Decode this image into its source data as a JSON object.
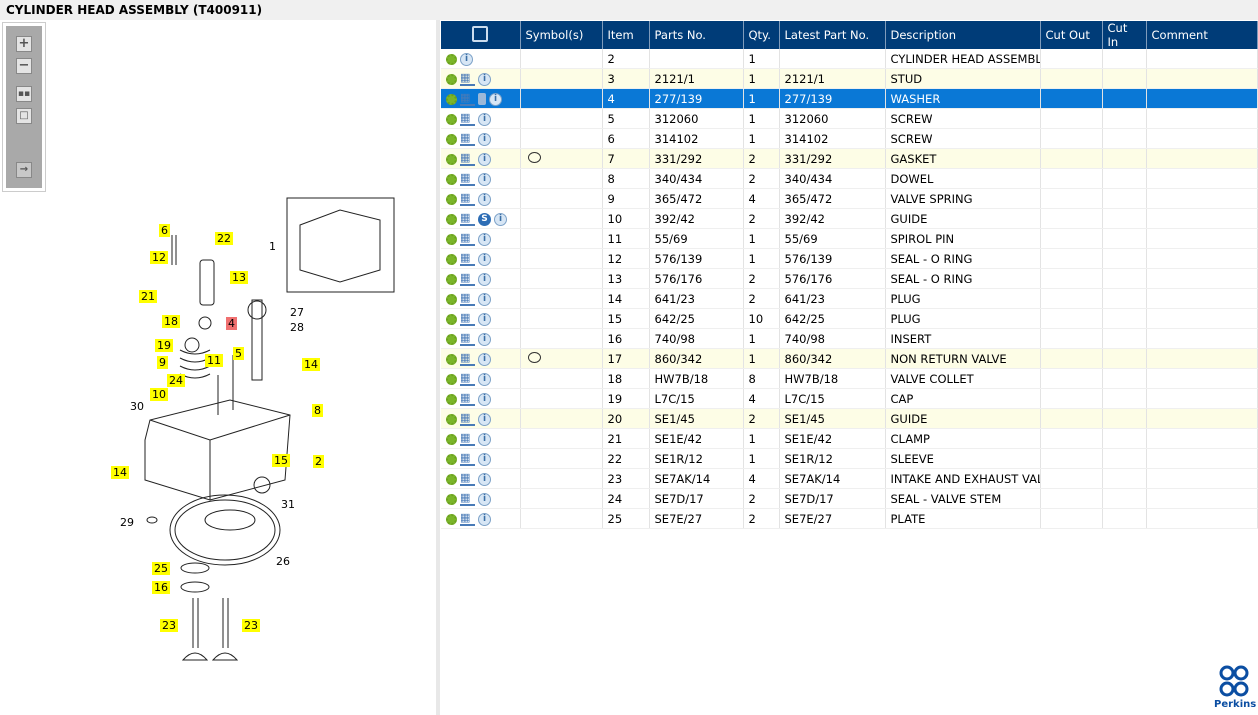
{
  "title": "CYLINDER HEAD ASSEMBLY (T400911)",
  "toolbar": {
    "zoom_in": "+",
    "zoom_out": "−"
  },
  "diagram": {
    "labels": [
      {
        "t": "6",
        "hl": "yellow"
      },
      {
        "t": "22",
        "hl": "yellow"
      },
      {
        "t": "12",
        "hl": "yellow"
      },
      {
        "t": "13",
        "hl": "yellow"
      },
      {
        "t": "21",
        "hl": "yellow"
      },
      {
        "t": "18",
        "hl": "yellow"
      },
      {
        "t": "4",
        "hl": "red"
      },
      {
        "t": "19",
        "hl": "yellow"
      },
      {
        "t": "5",
        "hl": "yellow"
      },
      {
        "t": "14",
        "hl": "yellow"
      },
      {
        "t": "9",
        "hl": "yellow"
      },
      {
        "t": "11",
        "hl": "yellow"
      },
      {
        "t": "24",
        "hl": "yellow"
      },
      {
        "t": "10",
        "hl": "yellow"
      },
      {
        "t": "8",
        "hl": "yellow"
      },
      {
        "t": "14",
        "hl": "yellow"
      },
      {
        "t": "15",
        "hl": "yellow"
      },
      {
        "t": "2",
        "hl": "yellow"
      },
      {
        "t": "25",
        "hl": "yellow"
      },
      {
        "t": "16",
        "hl": "yellow"
      },
      {
        "t": "23",
        "hl": "yellow"
      },
      {
        "t": "23",
        "hl": "yellow"
      }
    ],
    "plain_labels": [
      "1",
      "27",
      "28",
      "30",
      "31",
      "29",
      "26"
    ]
  },
  "grid": {
    "columns": [
      "",
      "Symbol(s)",
      "Item",
      "Parts No.",
      "Qty.",
      "Latest Part No.",
      "Description",
      "Cut Out",
      "Cut In",
      "Comment"
    ],
    "rows": [
      {
        "icons": [
          "gear",
          "info"
        ],
        "sym": "",
        "item": "2",
        "part": "",
        "qty": "1",
        "latest": "",
        "desc": "CYLINDER HEAD ASSEMBLY",
        "state": ""
      },
      {
        "icons": [
          "gear",
          "cart",
          "info"
        ],
        "sym": "",
        "item": "3",
        "part": "2121/1",
        "qty": "1",
        "latest": "2121/1",
        "desc": "STUD",
        "state": "hl"
      },
      {
        "icons": [
          "gear",
          "cart",
          "doc",
          "info"
        ],
        "sym": "",
        "item": "4",
        "part": "277/139",
        "qty": "1",
        "latest": "277/139",
        "desc": "WASHER",
        "state": "sel"
      },
      {
        "icons": [
          "gear",
          "cart",
          "info"
        ],
        "sym": "",
        "item": "5",
        "part": "312060",
        "qty": "1",
        "latest": "312060",
        "desc": "SCREW",
        "state": ""
      },
      {
        "icons": [
          "gear",
          "cart",
          "info"
        ],
        "sym": "",
        "item": "6",
        "part": "314102",
        "qty": "1",
        "latest": "314102",
        "desc": "SCREW",
        "state": ""
      },
      {
        "icons": [
          "gear",
          "cart",
          "info"
        ],
        "sym": "note",
        "item": "7",
        "part": "331/292",
        "qty": "2",
        "latest": "331/292",
        "desc": "GASKET",
        "state": "hl"
      },
      {
        "icons": [
          "gear",
          "cart",
          "info"
        ],
        "sym": "",
        "item": "8",
        "part": "340/434",
        "qty": "2",
        "latest": "340/434",
        "desc": "DOWEL",
        "state": ""
      },
      {
        "icons": [
          "gear",
          "cart",
          "info"
        ],
        "sym": "",
        "item": "9",
        "part": "365/472",
        "qty": "4",
        "latest": "365/472",
        "desc": "VALVE SPRING",
        "state": ""
      },
      {
        "icons": [
          "gear",
          "cart",
          "s",
          "info"
        ],
        "sym": "",
        "item": "10",
        "part": "392/42",
        "qty": "2",
        "latest": "392/42",
        "desc": "GUIDE",
        "state": ""
      },
      {
        "icons": [
          "gear",
          "cart",
          "info"
        ],
        "sym": "",
        "item": "11",
        "part": "55/69",
        "qty": "1",
        "latest": "55/69",
        "desc": "SPIROL PIN",
        "state": ""
      },
      {
        "icons": [
          "gear",
          "cart",
          "info"
        ],
        "sym": "",
        "item": "12",
        "part": "576/139",
        "qty": "1",
        "latest": "576/139",
        "desc": "SEAL - O RING",
        "state": ""
      },
      {
        "icons": [
          "gear",
          "cart",
          "info"
        ],
        "sym": "",
        "item": "13",
        "part": "576/176",
        "qty": "2",
        "latest": "576/176",
        "desc": "SEAL - O RING",
        "state": ""
      },
      {
        "icons": [
          "gear",
          "cart",
          "info"
        ],
        "sym": "",
        "item": "14",
        "part": "641/23",
        "qty": "2",
        "latest": "641/23",
        "desc": "PLUG",
        "state": ""
      },
      {
        "icons": [
          "gear",
          "cart",
          "info"
        ],
        "sym": "",
        "item": "15",
        "part": "642/25",
        "qty": "10",
        "latest": "642/25",
        "desc": "PLUG",
        "state": ""
      },
      {
        "icons": [
          "gear",
          "cart",
          "info"
        ],
        "sym": "",
        "item": "16",
        "part": "740/98",
        "qty": "1",
        "latest": "740/98",
        "desc": "INSERT",
        "state": ""
      },
      {
        "icons": [
          "gear",
          "cart",
          "info"
        ],
        "sym": "note",
        "item": "17",
        "part": "860/342",
        "qty": "1",
        "latest": "860/342",
        "desc": "NON RETURN VALVE",
        "state": "hl"
      },
      {
        "icons": [
          "gear",
          "cart",
          "info"
        ],
        "sym": "",
        "item": "18",
        "part": "HW7B/18",
        "qty": "8",
        "latest": "HW7B/18",
        "desc": "VALVE COLLET",
        "state": ""
      },
      {
        "icons": [
          "gear",
          "cart",
          "info"
        ],
        "sym": "",
        "item": "19",
        "part": "L7C/15",
        "qty": "4",
        "latest": "L7C/15",
        "desc": "CAP",
        "state": ""
      },
      {
        "icons": [
          "gear",
          "cart",
          "info"
        ],
        "sym": "",
        "item": "20",
        "part": "SE1/45",
        "qty": "2",
        "latest": "SE1/45",
        "desc": "GUIDE",
        "state": "hl"
      },
      {
        "icons": [
          "gear",
          "cart",
          "info"
        ],
        "sym": "",
        "item": "21",
        "part": "SE1E/42",
        "qty": "1",
        "latest": "SE1E/42",
        "desc": "CLAMP",
        "state": ""
      },
      {
        "icons": [
          "gear",
          "cart",
          "info"
        ],
        "sym": "",
        "item": "22",
        "part": "SE1R/12",
        "qty": "1",
        "latest": "SE1R/12",
        "desc": "SLEEVE",
        "state": ""
      },
      {
        "icons": [
          "gear",
          "cart",
          "info"
        ],
        "sym": "",
        "item": "23",
        "part": "SE7AK/14",
        "qty": "4",
        "latest": "SE7AK/14",
        "desc": "INTAKE AND EXHAUST VALVE",
        "state": ""
      },
      {
        "icons": [
          "gear",
          "cart",
          "info"
        ],
        "sym": "",
        "item": "24",
        "part": "SE7D/17",
        "qty": "2",
        "latest": "SE7D/17",
        "desc": "SEAL - VALVE STEM",
        "state": ""
      },
      {
        "icons": [
          "gear",
          "cart",
          "info"
        ],
        "sym": "",
        "item": "25",
        "part": "SE7E/27",
        "qty": "2",
        "latest": "SE7E/27",
        "desc": "PLATE",
        "state": ""
      }
    ]
  },
  "logo": {
    "text": "Perkins"
  },
  "colors": {
    "header": "#003c78",
    "selected": "#0a78d6",
    "highlight_row": "#fdfde6",
    "callout": "#ffff00",
    "callout_selected": "#f07070"
  }
}
